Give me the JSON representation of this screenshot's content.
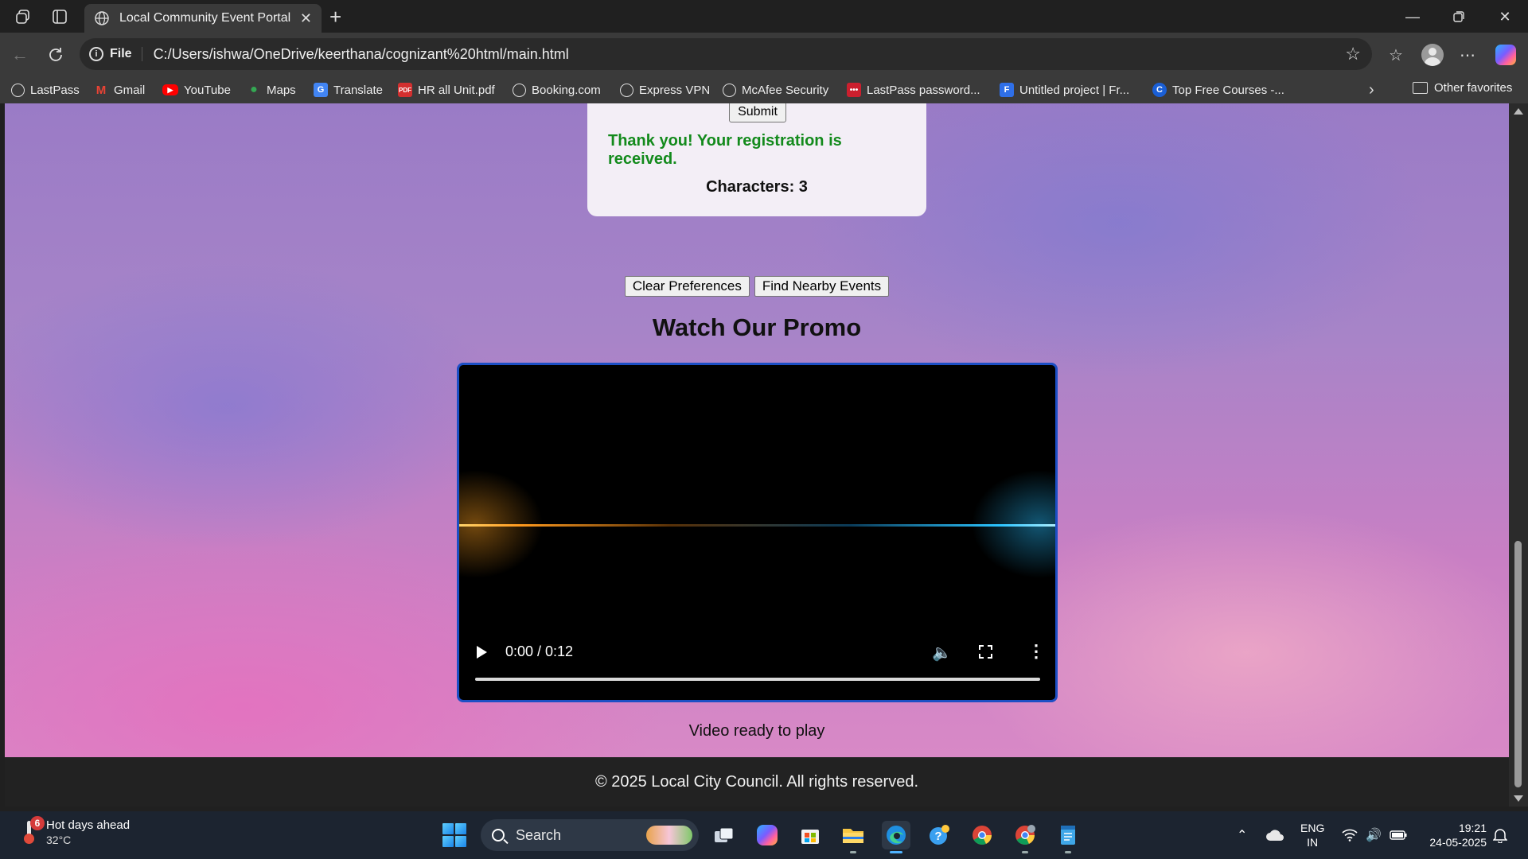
{
  "browser": {
    "tab_title": "Local Community Event Portal",
    "address_scheme": "File",
    "address_url": "C:/Users/ishwa/OneDrive/keerthana/cognizant%20html/main.html",
    "bookmarks": [
      {
        "label": "LastPass",
        "icon": "globe-icon"
      },
      {
        "label": "Gmail",
        "icon": "gmail-icon"
      },
      {
        "label": "YouTube",
        "icon": "youtube-icon"
      },
      {
        "label": "Maps",
        "icon": "maps-icon"
      },
      {
        "label": "Translate",
        "icon": "translate-icon"
      },
      {
        "label": "HR all Unit.pdf",
        "icon": "pdf-icon"
      },
      {
        "label": "Booking.com",
        "icon": "globe-icon"
      },
      {
        "label": "Express VPN",
        "icon": "globe-icon"
      },
      {
        "label": "McAfee Security",
        "icon": "globe-icon"
      },
      {
        "label": "LastPass password...",
        "icon": "lastpass-icon"
      },
      {
        "label": "Untitled project | Fr...",
        "icon": "document-icon"
      },
      {
        "label": "Top Free Courses -...",
        "icon": "course-icon"
      }
    ],
    "other_favorites": "Other favorites"
  },
  "page": {
    "submit_label": "Submit",
    "thank_you": "Thank you! Your registration is received.",
    "characters_label": "Characters: 3",
    "clear_preferences": "Clear Preferences",
    "find_nearby": "Find Nearby Events",
    "promo_title": "Watch Our Promo",
    "video_time": "0:00 / 0:12",
    "video_progress": 0,
    "video_status": "Video ready to play",
    "footer": "© 2025 Local City Council. All rights reserved."
  },
  "taskbar": {
    "weather_title": "Hot days ahead",
    "weather_temp": "32°C",
    "weather_badge": "6",
    "search_label": "Search",
    "lang_1": "ENG",
    "lang_2": "IN",
    "time": "19:21",
    "date": "24-05-2025"
  },
  "colors": {
    "accent_border": "#1c4fc4",
    "success_text": "#138a1c"
  }
}
